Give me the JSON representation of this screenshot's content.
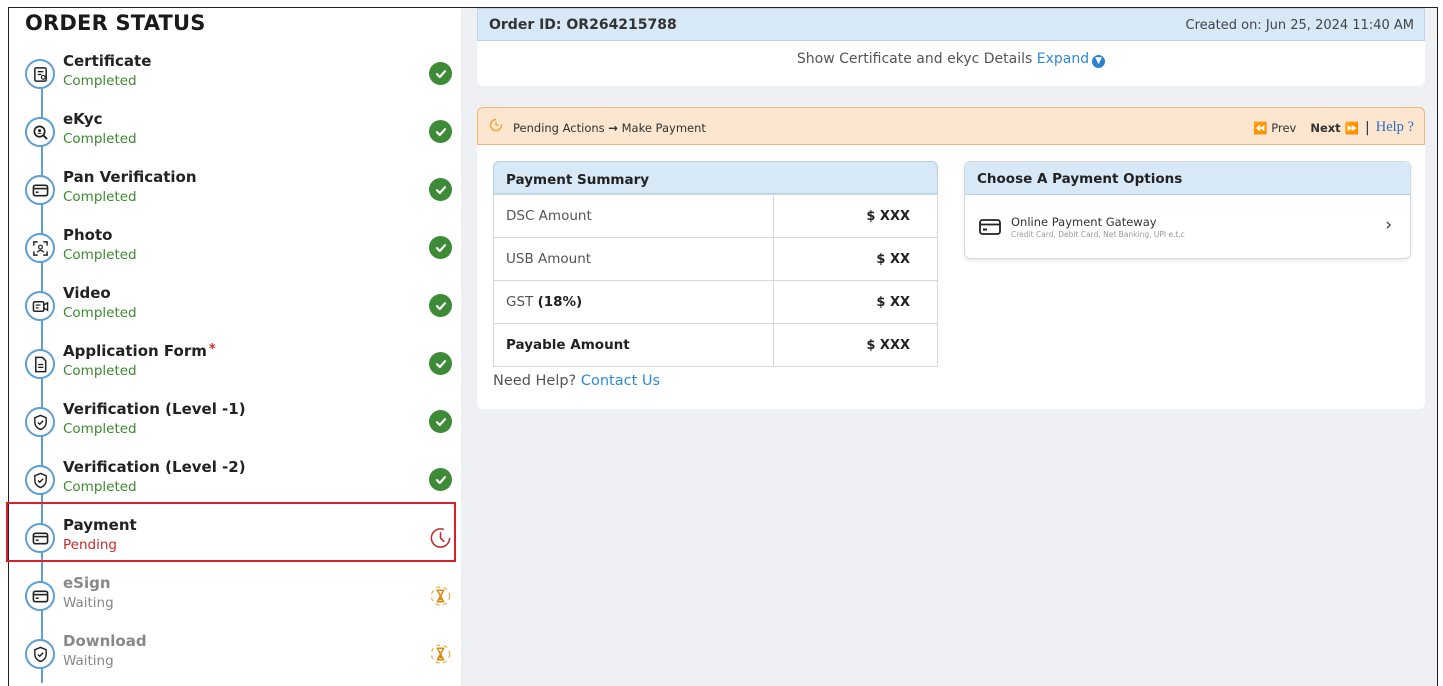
{
  "left": {
    "title": "ORDER STATUS",
    "steps": [
      {
        "name": "Certificate",
        "status": "Completed",
        "icon": "certificate-icon",
        "state": "completed"
      },
      {
        "name": "eKyc",
        "status": "Completed",
        "icon": "ekyc-search-icon",
        "state": "completed"
      },
      {
        "name": "Pan Verification",
        "status": "Completed",
        "icon": "card-icon",
        "state": "completed"
      },
      {
        "name": "Photo",
        "status": "Completed",
        "icon": "photo-scan-icon",
        "state": "completed"
      },
      {
        "name": "Video",
        "status": "Completed",
        "icon": "video-icon",
        "state": "completed"
      },
      {
        "name": "Application Form",
        "required_mark": "*",
        "status": "Completed",
        "icon": "document-icon",
        "state": "completed"
      },
      {
        "name": "Verification (Level -1)",
        "status": "Completed",
        "icon": "shield-check-icon",
        "state": "completed"
      },
      {
        "name": "Verification (Level -2)",
        "status": "Completed",
        "icon": "shield-check-icon",
        "state": "completed"
      },
      {
        "name": "Payment",
        "status": "Pending",
        "icon": "card-icon",
        "state": "pending"
      },
      {
        "name": "eSign",
        "status": "Waiting",
        "icon": "card-icon",
        "state": "waiting"
      },
      {
        "name": "Download",
        "status": "Waiting",
        "icon": "shield-check-icon",
        "state": "waiting"
      }
    ]
  },
  "order": {
    "id_text": "Order ID: OR264215788",
    "created_text": "Created on: Jun 25, 2024 11:40 AM",
    "details_text": "Show Certificate and ekyc Details",
    "expand_label": "Expand"
  },
  "pending_bar": {
    "text": "Pending Actions",
    "arrow": "→",
    "action": "Make Payment",
    "prev_label": "Prev",
    "next_label": "Next",
    "help_label": "Help ?"
  },
  "payment_summary": {
    "title": "Payment Summary",
    "rows": [
      {
        "label": "DSC Amount",
        "value": "$  XXX"
      },
      {
        "label": "USB Amount",
        "value": "$  XX"
      },
      {
        "label": "GST",
        "label_bold": "(18%)",
        "value": "$  XX"
      },
      {
        "label": "Payable Amount",
        "value": "$  XXX"
      }
    ],
    "help_text": "Need Help?",
    "contact_label": "Contact Us"
  },
  "payment_options": {
    "title": "Choose A Payment Options",
    "option_title": "Online Payment Gateway",
    "option_sub": "Credit Card, Debit Card, Net Banking, UPI e.t.c"
  },
  "colors": {
    "completed": "#3c8a2e",
    "pending": "#c62828",
    "waiting": "#888888",
    "timeline": "#5b9fd6",
    "header_blue": "#d7e8f6",
    "pending_bar": "#fce6cf",
    "link": "#2d8bd5",
    "highlight": "#d9202b"
  }
}
